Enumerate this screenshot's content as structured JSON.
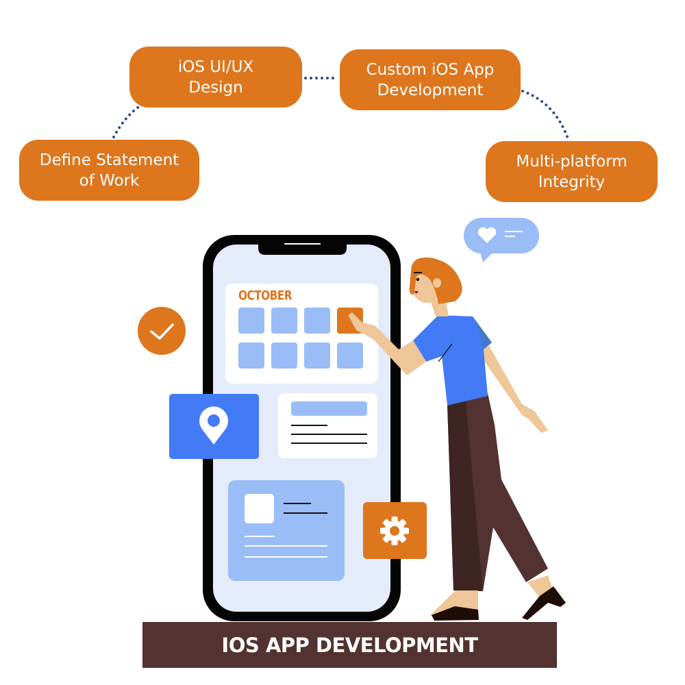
{
  "diagram": {
    "title": "IOS APP DEVELOPMENT",
    "steps": [
      {
        "label": "Define Statement\nof Work"
      },
      {
        "label": "iOS UI/UX\nDesign"
      },
      {
        "label": "Custom iOS App\nDevelopment"
      },
      {
        "label": "Multi-platform\nIntegrity"
      }
    ],
    "connectors": [
      {
        "from": "Define Statement of Work",
        "to": "iOS UI/UX Design",
        "style": "dotted"
      },
      {
        "from": "iOS UI/UX Design",
        "to": "Custom iOS App Development",
        "style": "dotted"
      },
      {
        "from": "Custom iOS App Development",
        "to": "Multi-platform Integrity",
        "style": "dotted"
      }
    ]
  },
  "illustration": {
    "calendar_month": "OCTOBER",
    "icons": [
      "check-icon",
      "location-pin-icon",
      "gear-icon",
      "heart-icon",
      "speech-bubble-icon",
      "smartphone-icon"
    ]
  },
  "colors": {
    "accent_orange": "#DD761D",
    "banner_brown": "#523331",
    "connector_blue": "#2E4A8C",
    "primary_blue": "#437AF5",
    "light_blue": "#9ABCF7",
    "screen_bg": "#E4ECFB"
  }
}
